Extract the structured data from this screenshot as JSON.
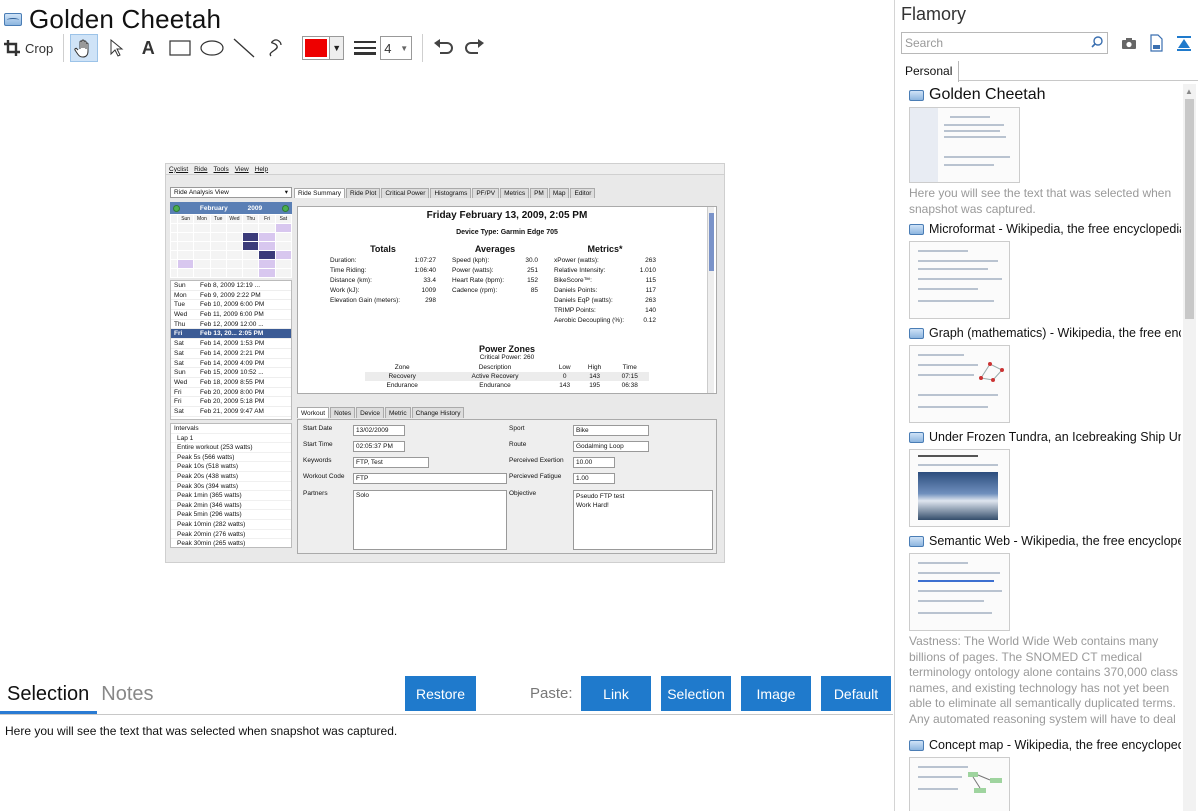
{
  "editor": {
    "document_title": "Golden Cheetah",
    "toolbar": {
      "crop_label": "Crop",
      "stroke_width": "4",
      "color": "#ee0000"
    },
    "bottom_tabs": {
      "selection": "Selection",
      "notes": "Notes"
    },
    "restore_label": "Restore",
    "paste_label": "Paste:",
    "paste_buttons": {
      "link": "Link",
      "selection": "Selection",
      "image": "Image",
      "default": "Default"
    },
    "selection_text": "Here you will see the text that was selected when snapshot was captured."
  },
  "screenshot": {
    "menu": [
      "Cyclist",
      "Ride",
      "Tools",
      "View",
      "Help"
    ],
    "view_select": "Ride Analysis View",
    "calendar_month": "February",
    "calendar_year": "2009",
    "calendar_days": [
      "Sun",
      "Mon",
      "Tue",
      "Wed",
      "Thu",
      "Fri",
      "Sat"
    ],
    "rides": [
      {
        "day": "Sun",
        "date": "Feb 8, 2009",
        "time": "12:19 ..."
      },
      {
        "day": "Mon",
        "date": "Feb 9, 2009",
        "time": "2:22 PM"
      },
      {
        "day": "Tue",
        "date": "Feb 10, 2009",
        "time": "6:00 PM"
      },
      {
        "day": "Wed",
        "date": "Feb 11, 2009",
        "time": "6:00 PM"
      },
      {
        "day": "Thu",
        "date": "Feb 12, 2009",
        "time": "12:00 ..."
      },
      {
        "day": "Fri",
        "date": "Feb 13, 20...",
        "time": "2:05 PM"
      },
      {
        "day": "Sat",
        "date": "Feb 14, 2009",
        "time": "1:53 PM"
      },
      {
        "day": "Sat",
        "date": "Feb 14, 2009",
        "time": "2:21 PM"
      },
      {
        "day": "Sat",
        "date": "Feb 14, 2009",
        "time": "4:09 PM"
      },
      {
        "day": "Sun",
        "date": "Feb 15, 2009",
        "time": "10:52 ..."
      },
      {
        "day": "Wed",
        "date": "Feb 18, 2009",
        "time": "8:55 PM"
      },
      {
        "day": "Fri",
        "date": "Feb 20, 2009",
        "time": "8:00 PM"
      },
      {
        "day": "Fri",
        "date": "Feb 20, 2009",
        "time": "5:18 PM"
      },
      {
        "day": "Sat",
        "date": "Feb 21, 2009",
        "time": "9:47 AM"
      }
    ],
    "intervals_header": "Intervals",
    "intervals": [
      "Lap 1",
      "Entire workout (253 watts)",
      "Peak 5s (566 watts)",
      "Peak 10s (518 watts)",
      "Peak 20s (438 watts)",
      "Peak 30s (394 watts)",
      "Peak 1min (365 watts)",
      "Peak 2min (346 watts)",
      "Peak 5min (296 watts)",
      "Peak 10min (282 watts)",
      "Peak 20min (276 watts)",
      "Peak 30min (265 watts)"
    ],
    "tabs": [
      "Ride Summary",
      "Ride Plot",
      "Critical Power",
      "Histograms",
      "PF/PV",
      "Metrics",
      "PM",
      "Map",
      "Editor"
    ],
    "summary_title": "Friday February 13, 2009, 2:05 PM",
    "device": "Device Type: Garmin Edge 705",
    "totals_title": "Totals",
    "totals": [
      {
        "k": "Duration:",
        "v": "1:07:27"
      },
      {
        "k": "Time Riding:",
        "v": "1:06:40"
      },
      {
        "k": "Distance (km):",
        "v": "33.4"
      },
      {
        "k": "Work (kJ):",
        "v": "1009"
      },
      {
        "k": "Elevation Gain (meters):",
        "v": "298"
      }
    ],
    "averages_title": "Averages",
    "averages": [
      {
        "k": "Speed (kph):",
        "v": "30.0"
      },
      {
        "k": "Power (watts):",
        "v": "251"
      },
      {
        "k": "Heart Rate (bpm):",
        "v": "152"
      },
      {
        "k": "Cadence (rpm):",
        "v": "85"
      }
    ],
    "metrics_title": "Metrics*",
    "metrics": [
      {
        "k": "xPower (watts):",
        "v": "263"
      },
      {
        "k": "Relative Intensity:",
        "v": "1.010"
      },
      {
        "k": "BikeScore™:",
        "v": "115"
      },
      {
        "k": "Daniels Points:",
        "v": "117"
      },
      {
        "k": "Daniels EqP (watts):",
        "v": "263"
      },
      {
        "k": "TRIMP Points:",
        "v": "140"
      },
      {
        "k": "Aerobic Decoupling (%):",
        "v": "0.12"
      }
    ],
    "power_zones_title": "Power Zones",
    "critical_power": "Critical Power: 260",
    "zone_headers": [
      "Zone",
      "Description",
      "Low",
      "High",
      "Time"
    ],
    "zones": [
      [
        "Recovery",
        "Active Recovery",
        "0",
        "143",
        "07:15"
      ],
      [
        "Endurance",
        "Endurance",
        "143",
        "195",
        "06:38"
      ]
    ],
    "lower_tabs": [
      "Workout",
      "Notes",
      "Device",
      "Metric",
      "Change History"
    ],
    "form": {
      "start_date_label": "Start Date",
      "start_date": "13/02/2009",
      "start_time_label": "Start Time",
      "start_time": "02:05:37 PM",
      "keywords_label": "Keywords",
      "keywords": "FTP, Test",
      "workout_code_label": "Workout Code",
      "workout_code": "FTP",
      "partners_label": "Partners",
      "partners": "Solo",
      "sport_label": "Sport",
      "sport": "Bike",
      "route_label": "Route",
      "route": "Godalming Loop",
      "exertion_label": "Perceived Exertion",
      "exertion": "10.00",
      "fatigue_label": "Percieved Fatigue",
      "fatigue": "1.00",
      "objective_label": "Objective",
      "objective_line1": "Pseudo FTP test",
      "objective_line2": "Work Hard!"
    }
  },
  "sidebar": {
    "title": "Flamory",
    "search_placeholder": "Search",
    "tab": "Personal",
    "snapshots": [
      {
        "title": "Golden Cheetah",
        "desc": "Here you will see the text that was selected when snapshot was captured."
      },
      {
        "title": "Microformat - Wikipedia, the free encyclopedia"
      },
      {
        "title": "Graph (mathematics) - Wikipedia, the free encyclopedia"
      },
      {
        "title": "Under Frozen Tundra, an Icebreaking Ship Uncovers"
      },
      {
        "title": "Semantic Web - Wikipedia, the free encyclopedia",
        "desc": "Vastness: The World Wide Web contains many billions of pages. The SNOMED CT medical terminology ontology alone contains 370,000 class names, and existing technology has not yet been able to eliminate all semantically duplicated terms. Any automated reasoning system will have to deal with truly huge inputs."
      },
      {
        "title": "Concept map - Wikipedia, the free encyclopedia"
      }
    ]
  }
}
